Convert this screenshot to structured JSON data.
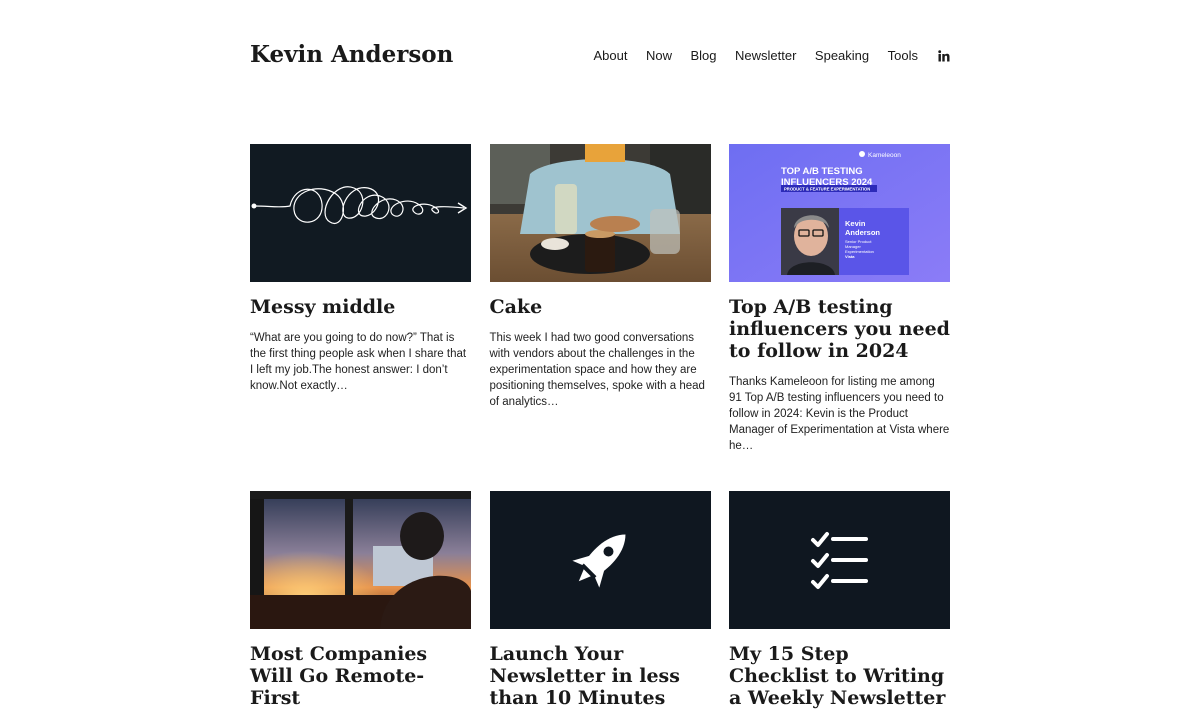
{
  "site": {
    "title": "Kevin Anderson"
  },
  "nav": {
    "items": [
      {
        "label": "About"
      },
      {
        "label": "Now"
      },
      {
        "label": "Blog"
      },
      {
        "label": "Newsletter"
      },
      {
        "label": "Speaking"
      },
      {
        "label": "Tools"
      }
    ],
    "social_icon": "linkedin-icon"
  },
  "posts": [
    {
      "title": "Messy middle",
      "excerpt": "“What are you going to do now?” That is the first thing people ask when I share that I left my job.The honest answer: I don’t know.Not exactly…",
      "image": "tangled-line-arrow"
    },
    {
      "title": "Cake",
      "excerpt": "This week I had two good conversations with vendors about the challenges in the experimentation space and how they are positioning themselves, spoke with a head of analytics…",
      "image": "cafe-table-photo"
    },
    {
      "title": "Top A/B testing influencers you need to follow in 2024",
      "excerpt": "Thanks Kameleoon for listing me among 91 Top A/B testing influencers you need to follow in 2024: Kevin is the Product Manager of Experimentation at Vista where he…",
      "image": "kameleoon-banner",
      "banner": {
        "brand": "Kameleoon",
        "line1": "TOP A/B TESTING",
        "line2": "INFLUENCERS 2024",
        "tag": "PRODUCT & FEATURE EXPERIMENTATION",
        "name_first": "Kevin",
        "name_last": "Anderson",
        "role1": "Senior Product",
        "role2": "Manager",
        "role3": "Experimentation",
        "company": "Vista"
      }
    },
    {
      "title": "Most Companies Will Go Remote-First",
      "excerpt": "",
      "image": "sunset-desk-photo"
    },
    {
      "title": "Launch Your Newsletter in less than 10 Minutes",
      "excerpt": "",
      "image": "rocket-icon"
    },
    {
      "title": "My 15 Step Checklist to Writing a Weekly Newsletter",
      "excerpt": "",
      "image": "checklist-icon"
    }
  ],
  "colors": {
    "dark_tile": "#0f1720",
    "banner_blue": "#6a6cf0",
    "text": "#1a1a1a"
  }
}
